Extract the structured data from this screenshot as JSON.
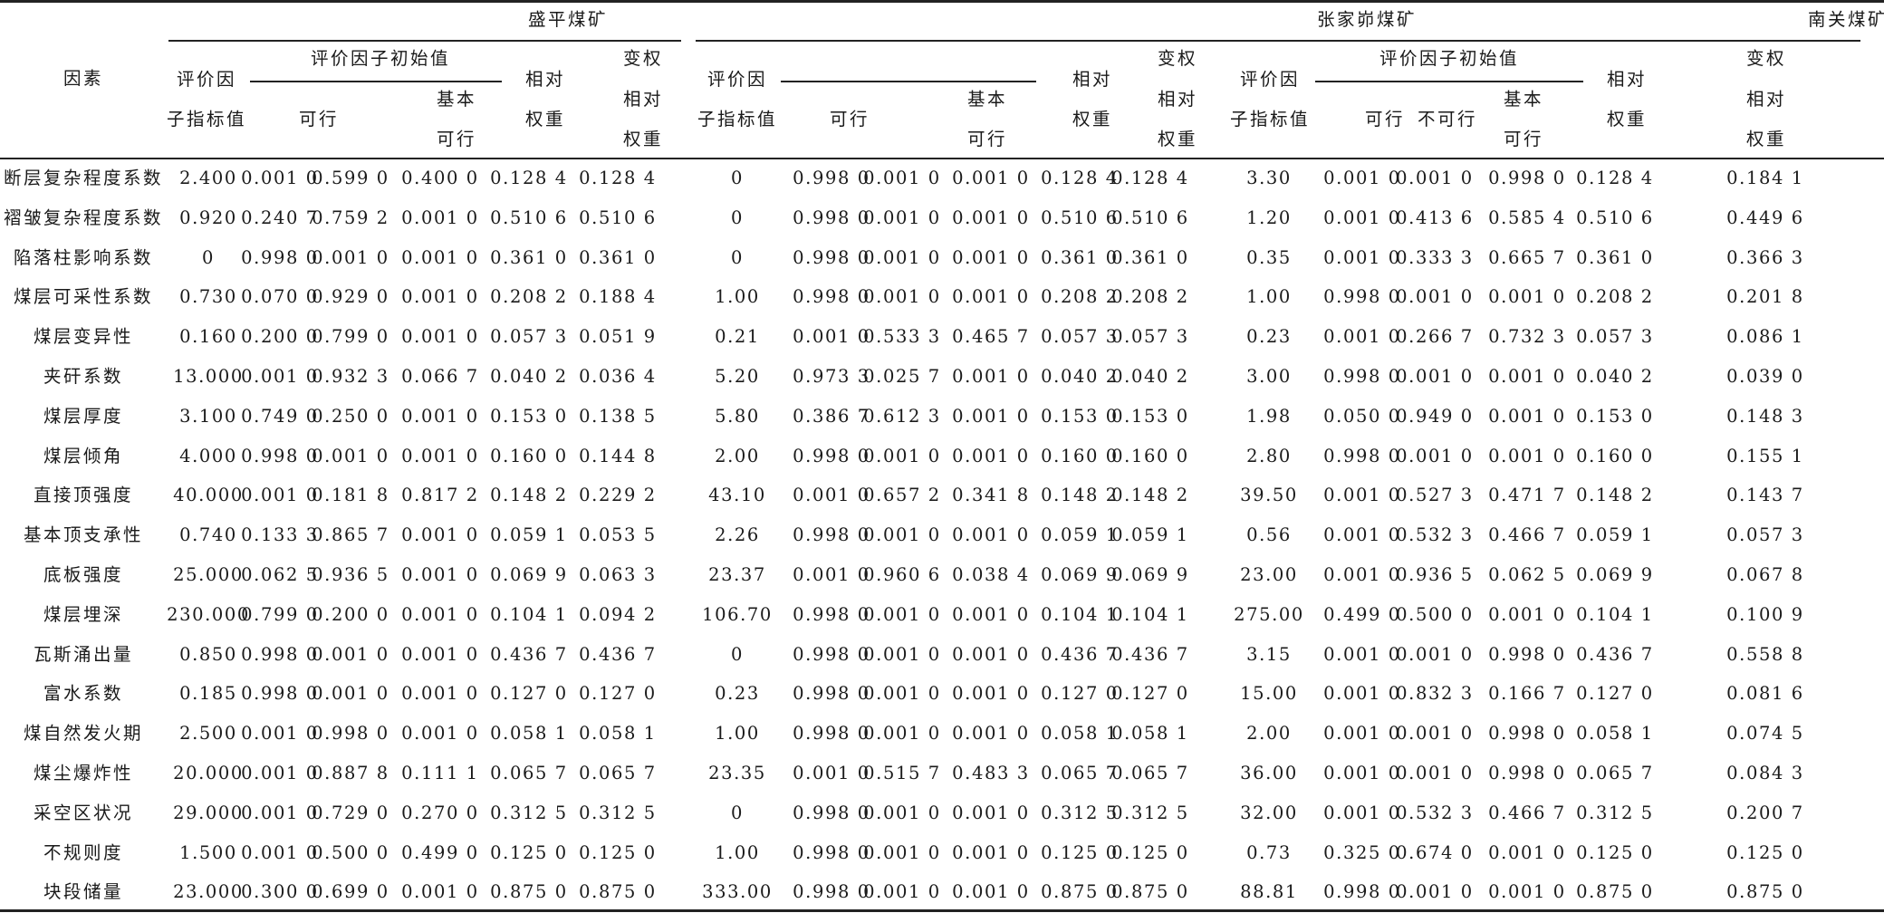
{
  "table": {
    "groups": [
      {
        "name": "盛平煤矿"
      },
      {
        "name": "张家峁煤矿"
      },
      {
        "name": "南关煤矿"
      }
    ],
    "factor_header": "因素",
    "index_value_header": [
      "评价因",
      "子指标值"
    ],
    "initial_value_header": "评价因子初始值",
    "feasible": "可行",
    "infeasible": "不可行",
    "basic_feasible": [
      "基本",
      "可行"
    ],
    "relative_weight": [
      "相对",
      "权重"
    ],
    "variable_weight": [
      "变权",
      "相对",
      "权重"
    ],
    "rows": [
      {
        "factor": "断层复杂程度系数",
        "values": [
          "2.400",
          "0.001 0",
          "0.599 0",
          "0.400 0",
          "0.128 4",
          "0.128 4",
          "0",
          "0.998 0",
          "0.001 0",
          "0.001 0",
          "0.128 4",
          "0.128 4",
          "3.30",
          "0.001 0",
          "0.001 0",
          "0.998 0",
          "0.128 4",
          "0.184 1"
        ]
      },
      {
        "factor": "褶皱复杂程度系数",
        "values": [
          "0.920",
          "0.240 7",
          "0.759 2",
          "0.001 0",
          "0.510 6",
          "0.510 6",
          "0",
          "0.998 0",
          "0.001 0",
          "0.001 0",
          "0.510 6",
          "0.510 6",
          "1.20",
          "0.001 0",
          "0.413 6",
          "0.585 4",
          "0.510 6",
          "0.449 6"
        ]
      },
      {
        "factor": "陷落柱影响系数",
        "values": [
          "0",
          "0.998 0",
          "0.001 0",
          "0.001 0",
          "0.361 0",
          "0.361 0",
          "0",
          "0.998 0",
          "0.001 0",
          "0.001 0",
          "0.361 0",
          "0.361 0",
          "0.35",
          "0.001 0",
          "0.333 3",
          "0.665 7",
          "0.361 0",
          "0.366 3"
        ]
      },
      {
        "factor": "煤层可采性系数",
        "values": [
          "0.730",
          "0.070 0",
          "0.929 0",
          "0.001 0",
          "0.208 2",
          "0.188 4",
          "1.00",
          "0.998 0",
          "0.001 0",
          "0.001 0",
          "0.208 2",
          "0.208 2",
          "1.00",
          "0.998 0",
          "0.001 0",
          "0.001 0",
          "0.208 2",
          "0.201 8"
        ]
      },
      {
        "factor": "煤层变异性",
        "values": [
          "0.160",
          "0.200 0",
          "0.799 0",
          "0.001 0",
          "0.057 3",
          "0.051 9",
          "0.21",
          "0.001 0",
          "0.533 3",
          "0.465 7",
          "0.057 3",
          "0.057 3",
          "0.23",
          "0.001 0",
          "0.266 7",
          "0.732 3",
          "0.057 3",
          "0.086 1"
        ]
      },
      {
        "factor": "夹矸系数",
        "values": [
          "13.000",
          "0.001 0",
          "0.932 3",
          "0.066 7",
          "0.040 2",
          "0.036 4",
          "5.20",
          "0.973 3",
          "0.025 7",
          "0.001 0",
          "0.040 2",
          "0.040 2",
          "3.00",
          "0.998 0",
          "0.001 0",
          "0.001 0",
          "0.040 2",
          "0.039 0"
        ]
      },
      {
        "factor": "煤层厚度",
        "values": [
          "3.100",
          "0.749 0",
          "0.250 0",
          "0.001 0",
          "0.153 0",
          "0.138 5",
          "5.80",
          "0.386 7",
          "0.612 3",
          "0.001 0",
          "0.153 0",
          "0.153 0",
          "1.98",
          "0.050 0",
          "0.949 0",
          "0.001 0",
          "0.153 0",
          "0.148 3"
        ]
      },
      {
        "factor": "煤层倾角",
        "values": [
          "4.000",
          "0.998 0",
          "0.001 0",
          "0.001 0",
          "0.160 0",
          "0.144 8",
          "2.00",
          "0.998 0",
          "0.001 0",
          "0.001 0",
          "0.160 0",
          "0.160 0",
          "2.80",
          "0.998 0",
          "0.001 0",
          "0.001 0",
          "0.160 0",
          "0.155 1"
        ]
      },
      {
        "factor": "直接顶强度",
        "values": [
          "40.000",
          "0.001 0",
          "0.181 8",
          "0.817 2",
          "0.148 2",
          "0.229 2",
          "43.10",
          "0.001 0",
          "0.657 2",
          "0.341 8",
          "0.148 2",
          "0.148 2",
          "39.50",
          "0.001 0",
          "0.527 3",
          "0.471 7",
          "0.148 2",
          "0.143 7"
        ]
      },
      {
        "factor": "基本顶支承性",
        "values": [
          "0.740",
          "0.133 3",
          "0.865 7",
          "0.001 0",
          "0.059 1",
          "0.053 5",
          "2.26",
          "0.998 0",
          "0.001 0",
          "0.001 0",
          "0.059 1",
          "0.059 1",
          "0.56",
          "0.001 0",
          "0.532 3",
          "0.466 7",
          "0.059 1",
          "0.057 3"
        ]
      },
      {
        "factor": "底板强度",
        "values": [
          "25.000",
          "0.062 5",
          "0.936 5",
          "0.001 0",
          "0.069 9",
          "0.063 3",
          "23.37",
          "0.001 0",
          "0.960 6",
          "0.038 4",
          "0.069 9",
          "0.069 9",
          "23.00",
          "0.001 0",
          "0.936 5",
          "0.062 5",
          "0.069 9",
          "0.067 8"
        ]
      },
      {
        "factor": "煤层埋深",
        "values": [
          "230.000",
          "0.799 0",
          "0.200 0",
          "0.001 0",
          "0.104 1",
          "0.094 2",
          "106.70",
          "0.998 0",
          "0.001 0",
          "0.001 0",
          "0.104 1",
          "0.104 1",
          "275.00",
          "0.499 0",
          "0.500 0",
          "0.001 0",
          "0.104 1",
          "0.100 9"
        ]
      },
      {
        "factor": "瓦斯涌出量",
        "values": [
          "0.850",
          "0.998 0",
          "0.001 0",
          "0.001 0",
          "0.436 7",
          "0.436 7",
          "0",
          "0.998 0",
          "0.001 0",
          "0.001 0",
          "0.436 7",
          "0.436 7",
          "3.15",
          "0.001 0",
          "0.001 0",
          "0.998 0",
          "0.436 7",
          "0.558 8"
        ]
      },
      {
        "factor": "富水系数",
        "values": [
          "0.185",
          "0.998 0",
          "0.001 0",
          "0.001 0",
          "0.127 0",
          "0.127 0",
          "0.23",
          "0.998 0",
          "0.001 0",
          "0.001 0",
          "0.127 0",
          "0.127 0",
          "15.00",
          "0.001 0",
          "0.832 3",
          "0.166 7",
          "0.127 0",
          "0.081 6"
        ]
      },
      {
        "factor": "煤自然发火期",
        "values": [
          "2.500",
          "0.001 0",
          "0.998 0",
          "0.001 0",
          "0.058 1",
          "0.058 1",
          "1.00",
          "0.998 0",
          "0.001 0",
          "0.001 0",
          "0.058 1",
          "0.058 1",
          "2.00",
          "0.001 0",
          "0.001 0",
          "0.998 0",
          "0.058 1",
          "0.074 5"
        ]
      },
      {
        "factor": "煤尘爆炸性",
        "values": [
          "20.000",
          "0.001 0",
          "0.887 8",
          "0.111 1",
          "0.065 7",
          "0.065 7",
          "23.35",
          "0.001 0",
          "0.515 7",
          "0.483 3",
          "0.065 7",
          "0.065 7",
          "36.00",
          "0.001 0",
          "0.001 0",
          "0.998 0",
          "0.065 7",
          "0.084 3"
        ]
      },
      {
        "factor": "采空区状况",
        "values": [
          "29.000",
          "0.001 0",
          "0.729 0",
          "0.270 0",
          "0.312 5",
          "0.312 5",
          "0",
          "0.998 0",
          "0.001 0",
          "0.001 0",
          "0.312 5",
          "0.312 5",
          "32.00",
          "0.001 0",
          "0.532 3",
          "0.466 7",
          "0.312 5",
          "0.200 7"
        ]
      },
      {
        "factor": "不规则度",
        "values": [
          "1.500",
          "0.001 0",
          "0.500 0",
          "0.499 0",
          "0.125 0",
          "0.125 0",
          "1.00",
          "0.998 0",
          "0.001 0",
          "0.001 0",
          "0.125 0",
          "0.125 0",
          "0.73",
          "0.325 0",
          "0.674 0",
          "0.001 0",
          "0.125 0",
          "0.125 0"
        ]
      },
      {
        "factor": "块段储量",
        "values": [
          "23.000",
          "0.300 0",
          "0.699 0",
          "0.001 0",
          "0.875 0",
          "0.875 0",
          "333.00",
          "0.998 0",
          "0.001 0",
          "0.001 0",
          "0.875 0",
          "0.875 0",
          "88.81",
          "0.998 0",
          "0.001 0",
          "0.001 0",
          "0.875 0",
          "0.875 0"
        ]
      }
    ]
  }
}
